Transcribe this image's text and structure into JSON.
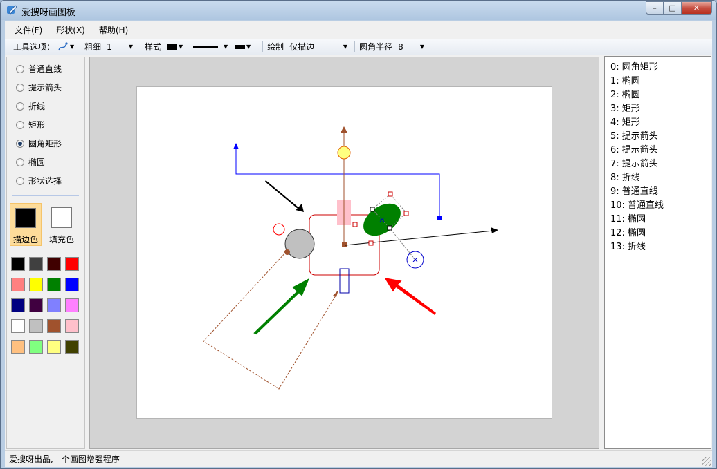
{
  "window": {
    "title": "爱搜呀画图板",
    "close_glyph": "✕",
    "max_glyph": "□",
    "min_glyph": "–"
  },
  "menu": [
    {
      "label": "文件(F)"
    },
    {
      "label": "形状(X)"
    },
    {
      "label": "帮助(H)"
    }
  ],
  "toolbar": {
    "tools_label": "工具选项：",
    "thickness_label": "粗细",
    "thickness_value": "1",
    "style_label": "样式",
    "draw_label": "绘制",
    "draw_value": "仅描边",
    "radius_label": "圆角半径",
    "radius_value": "8"
  },
  "shape_tools": [
    {
      "label": "普通直线",
      "selected": false
    },
    {
      "label": "提示箭头",
      "selected": false
    },
    {
      "label": "折线",
      "selected": false
    },
    {
      "label": "矩形",
      "selected": false
    },
    {
      "label": "圆角矩形",
      "selected": true
    },
    {
      "label": "椭圆",
      "selected": false
    },
    {
      "label": "形状选择",
      "selected": false
    }
  ],
  "colors": {
    "stroke_label": "描边色",
    "fill_label": "填充色",
    "stroke_color": "#000000",
    "fill_color": "#ffffff",
    "palette": [
      "#000000",
      "#404040",
      "#400000",
      "#ff0000",
      "#ff8080",
      "#ffff00",
      "#008000",
      "#0000ff",
      "#000080",
      "#400040",
      "#8080ff",
      "#ff80ff",
      "#ffffff",
      "#c0c0c0",
      "#a0522d",
      "#ffc0cb",
      "#ffc080",
      "#80ff80",
      "#ffff80",
      "#404000"
    ]
  },
  "shape_list": [
    "0: 圆角矩形",
    "1: 椭圆",
    "2: 椭圆",
    "3: 矩形",
    "4: 矩形",
    "5: 提示箭头",
    "6: 提示箭头",
    "7: 提示箭头",
    "8: 折线",
    "9: 普通直线",
    "10: 普通直线",
    "11: 椭圆",
    "12: 椭圆",
    "13: 折线"
  ],
  "status": {
    "text": "爱搜呀出品,一个画图增强程序"
  }
}
